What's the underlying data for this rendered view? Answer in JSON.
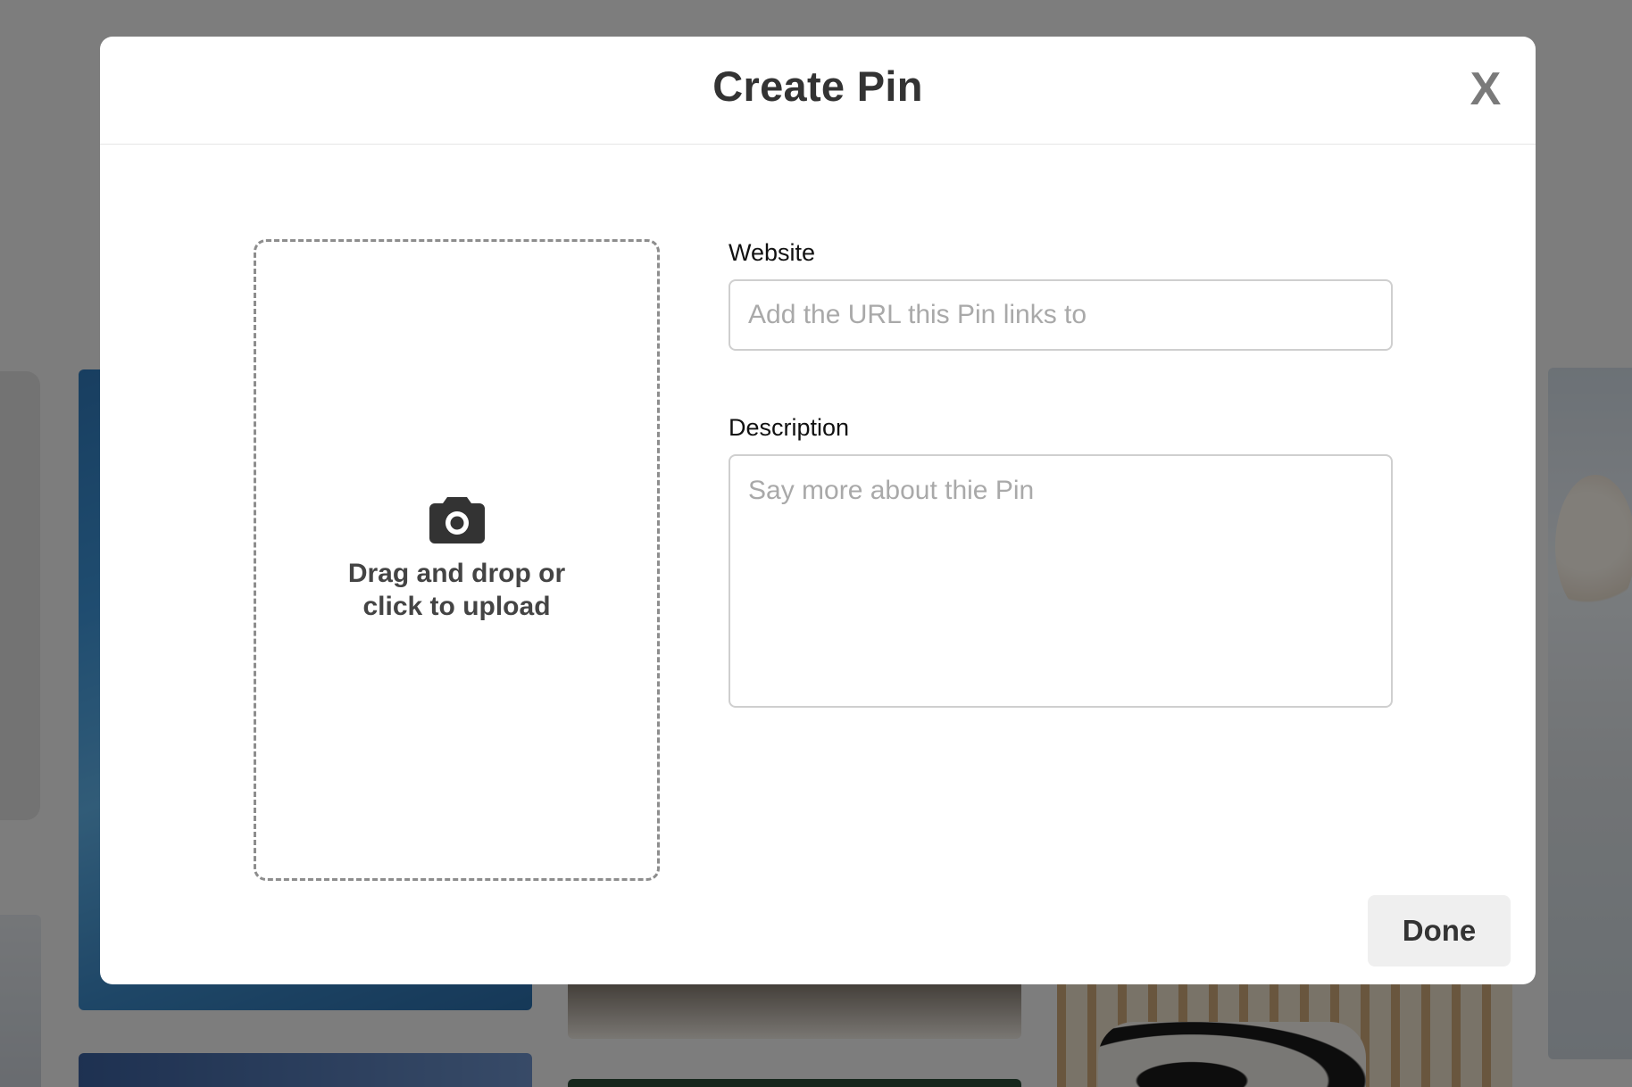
{
  "modal": {
    "title": "Create Pin",
    "close_label": "X"
  },
  "upload": {
    "icon": "camera-icon",
    "line1": "Drag and drop or",
    "line2": "click to upload"
  },
  "form": {
    "website": {
      "label": "Website",
      "placeholder": "Add the URL this Pin links to",
      "value": ""
    },
    "description": {
      "label": "Description",
      "placeholder": "Say more about thie Pin",
      "value": ""
    }
  },
  "actions": {
    "done_label": "Done"
  },
  "colors": {
    "overlay": "#00000079",
    "modal_bg": "#ffffff",
    "title_text": "#333333",
    "close_text": "#7a7a7a",
    "dashed_border": "#8d8d8d",
    "input_border": "#cfcfcf",
    "placeholder": "#a9a9a9",
    "done_bg": "#efefef"
  }
}
